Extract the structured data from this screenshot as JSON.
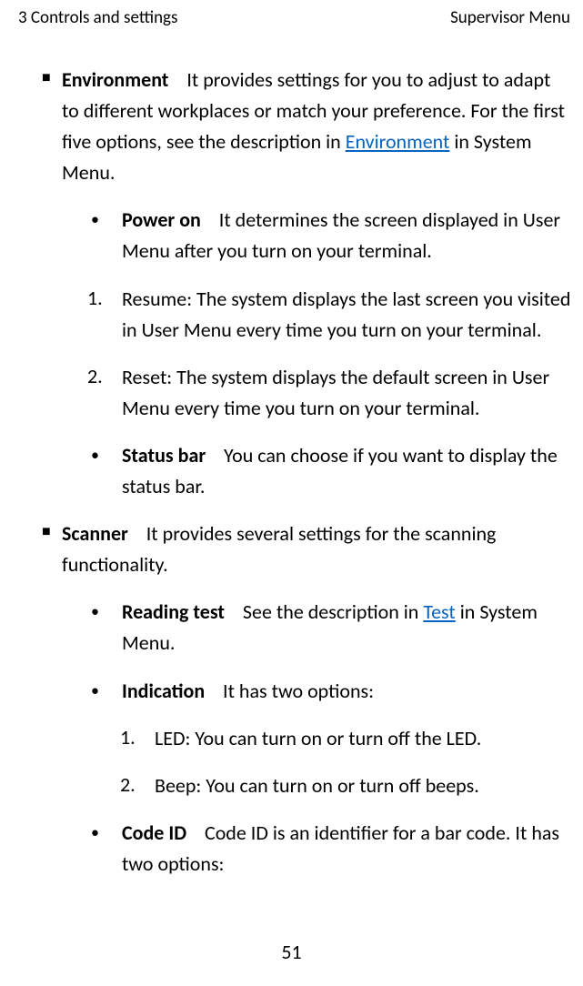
{
  "header": {
    "left": "3 Controls and settings",
    "right": "Supervisor Menu"
  },
  "environment": {
    "title": "Environment",
    "desc_before": "It provides settings for you to adjust to adapt to different workplaces or match your preference. For the first five options, see the description in ",
    "link": "Environment",
    "desc_after": " in System Menu.",
    "power_on": {
      "title": "Power on",
      "desc": "It determines the screen displayed in User Menu after you turn on your terminal."
    },
    "resume": {
      "num": "1.",
      "text": "Resume: The system displays the last screen you visited in User Menu every time you turn on your terminal."
    },
    "reset": {
      "num": "2.",
      "text": "Reset: The system displays the default screen in User Menu every time you turn on your terminal."
    },
    "status_bar": {
      "title": "Status bar",
      "desc": "You can choose if you want to display the status bar."
    }
  },
  "scanner": {
    "title": "Scanner",
    "desc": "It provides several settings for the scanning functionality.",
    "reading_test": {
      "title": "Reading test",
      "before": "See the description in ",
      "link": "Test",
      "after": " in System Menu."
    },
    "indication": {
      "title": "Indication",
      "desc": "It has two options:",
      "led": {
        "num": "1.",
        "text": "LED: You can turn on or turn off the LED."
      },
      "beep": {
        "num": "2.",
        "text": "Beep: You can turn on or turn off beeps."
      }
    },
    "code_id": {
      "title": "Code ID",
      "desc": "Code ID is an identifier for a bar code. It has two options:"
    }
  },
  "page_number": "51"
}
